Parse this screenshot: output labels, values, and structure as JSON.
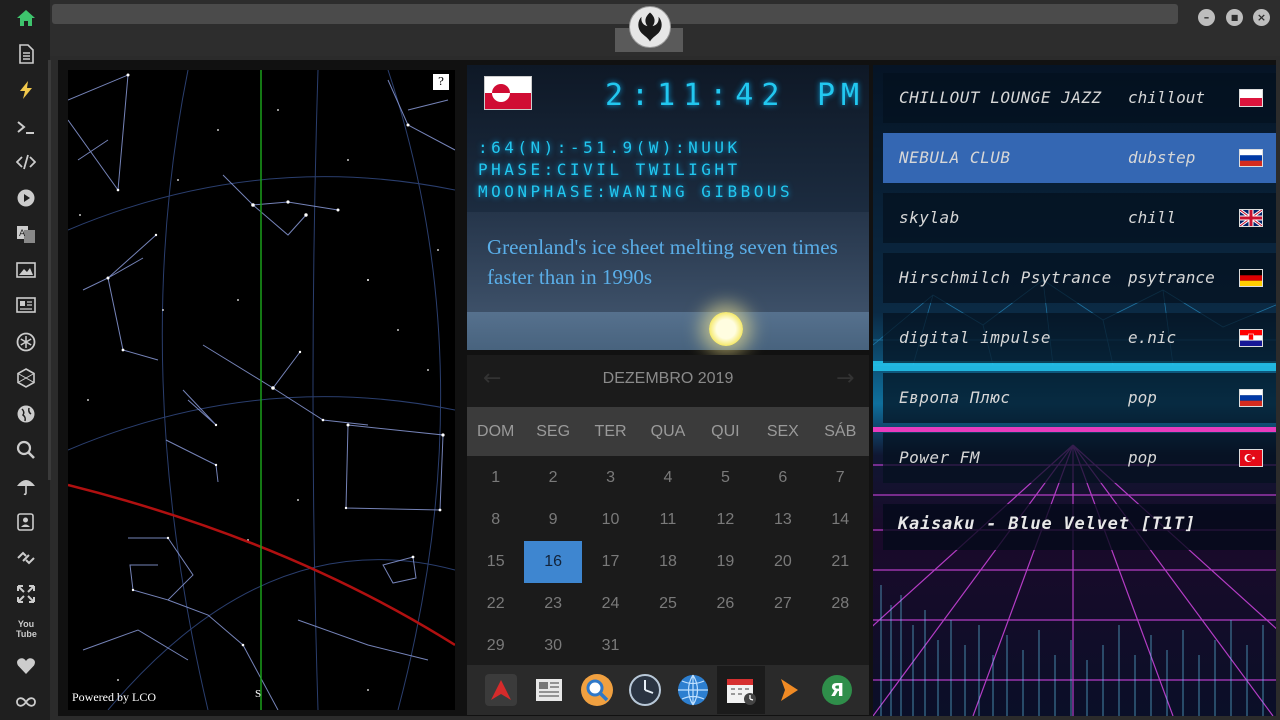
{
  "sidebar": {
    "icons": [
      "home-icon",
      "document-icon",
      "lightning-icon",
      "terminal-icon",
      "code-icon",
      "play-icon",
      "translate-icon",
      "image-icon",
      "news-icon",
      "aperture-icon",
      "hexagon-icon",
      "globe-icon",
      "search-icon",
      "umbrella-icon",
      "contact-icon",
      "link-icon",
      "expand-icon",
      "youtube-icon",
      "heart-icon",
      "infinity-icon"
    ],
    "youtube_label": "You Tube",
    "home_color": "#3ec46d"
  },
  "window": {
    "minimize": "–",
    "maximize": "■",
    "close": "×"
  },
  "sky_widget": {
    "help": "?",
    "powered": "Powered by LCO",
    "south": "S"
  },
  "clock": {
    "time": "2:11:42",
    "ampm": "PM",
    "coords": ":64(N):-51.9(W):NUUK",
    "phase": "PHASE:CIVIL TWILIGHT",
    "moonphase": "MOONPHASE:WANING GIBBOUS",
    "color": "#22c8f0"
  },
  "news": {
    "headline": "Greenland's ice sheet melting seven times faster than in 1990s"
  },
  "calendar": {
    "month": "DEZEMBRO 2019",
    "prev": "←",
    "next": "→",
    "days_of_week": [
      "DOM",
      "SEG",
      "TER",
      "QUA",
      "QUI",
      "SEX",
      "SÁB"
    ],
    "weeks": [
      [
        "1",
        "2",
        "3",
        "4",
        "5",
        "6",
        "7"
      ],
      [
        "8",
        "9",
        "10",
        "11",
        "12",
        "13",
        "14"
      ],
      [
        "15",
        "16",
        "17",
        "18",
        "19",
        "20",
        "21"
      ],
      [
        "22",
        "23",
        "24",
        "25",
        "26",
        "27",
        "28"
      ],
      [
        "29",
        "30",
        "31",
        "",
        "",
        "",
        ""
      ]
    ],
    "selected": "16",
    "selected_color": "#3e86d0"
  },
  "dock": {
    "items": [
      "app-launcher-icon",
      "news-app-icon",
      "search-app-icon",
      "clock-app-icon",
      "globe-app-icon",
      "calendar-app-icon",
      "play-app-icon",
      "yandex-app-icon"
    ],
    "yandex_letter": "Я"
  },
  "radio": {
    "stations": [
      {
        "name": "CHILLOUT LOUNGE JAZZ",
        "genre": "chillout",
        "flag": "poland"
      },
      {
        "name": "NEBULA CLUB",
        "genre": "dubstep",
        "flag": "russia"
      },
      {
        "name": "skylab",
        "genre": "chill",
        "flag": "uk"
      },
      {
        "name": "Hirschmilch Psytrance",
        "genre": "psytrance",
        "flag": "germany"
      },
      {
        "name": "digital impulse",
        "genre": "e.nic",
        "flag": "croatia"
      },
      {
        "name": "Европа Плюс",
        "genre": "pop",
        "flag": "russia"
      },
      {
        "name": "Power FM",
        "genre": "pop",
        "flag": "turkey"
      }
    ],
    "selected": "NEBULA CLUB",
    "now_playing": "Kaisaku - Blue Velvet [T1T]"
  }
}
